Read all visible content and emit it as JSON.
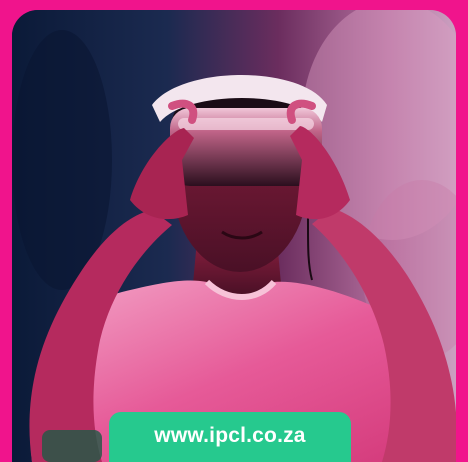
{
  "cta": {
    "url_text": "www.ipcl.co.za"
  },
  "colors": {
    "border": "#f0148c",
    "cta_background": "#26c98e",
    "cta_text": "#ffffff"
  }
}
